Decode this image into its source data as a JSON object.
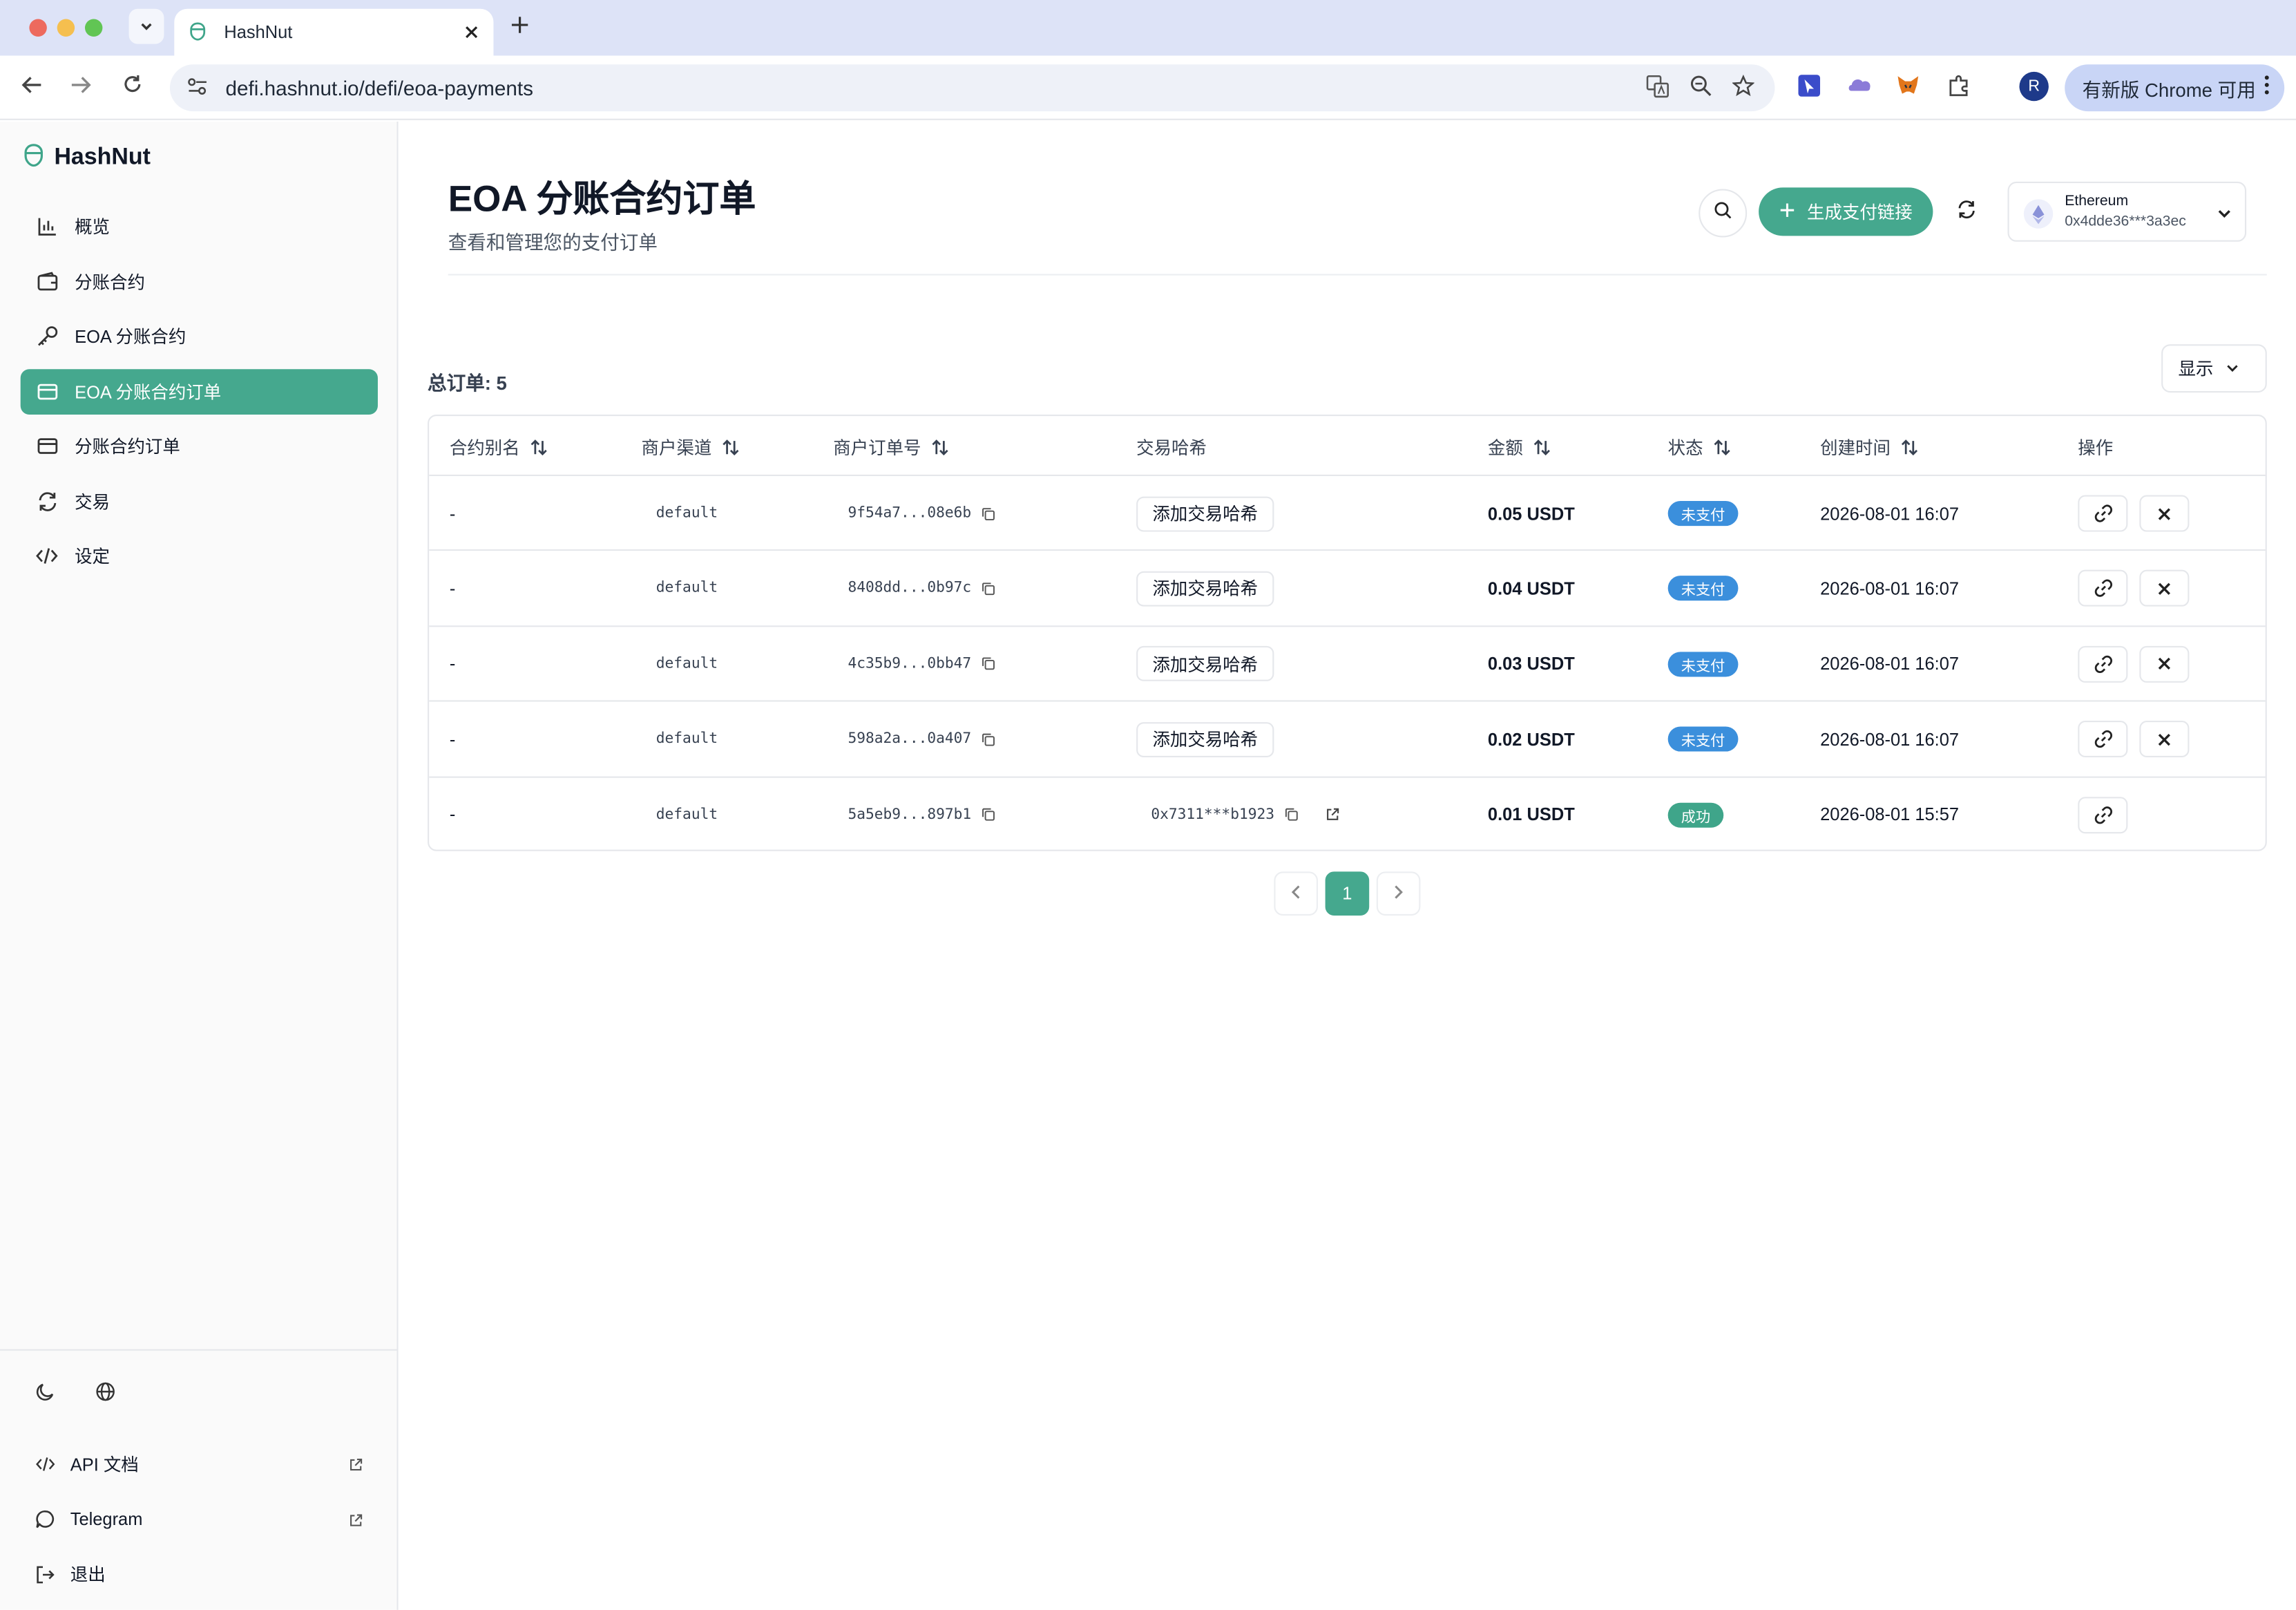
{
  "browser": {
    "tab_title": "HashNut",
    "url": "defi.hashnut.io/defi/eoa-payments",
    "profile_initial": "R",
    "update_label": "有新版 Chrome 可用"
  },
  "sidebar": {
    "brand": "HashNut",
    "items": [
      {
        "label": "概览",
        "icon": "bar-chart-icon"
      },
      {
        "label": "分账合约",
        "icon": "wallet-icon"
      },
      {
        "label": "EOA 分账合约",
        "icon": "key-icon"
      },
      {
        "label": "EOA 分账合约订单",
        "icon": "card-icon"
      },
      {
        "label": "分账合约订单",
        "icon": "card-icon"
      },
      {
        "label": "交易",
        "icon": "refresh-icon"
      },
      {
        "label": "设定",
        "icon": "code-icon"
      }
    ],
    "footer": {
      "api_docs": "API 文档",
      "telegram": "Telegram",
      "logout": "退出"
    }
  },
  "header": {
    "title": "EOA 分账合约订单",
    "subtitle": "查看和管理您的支付订单",
    "generate_label": "生成支付链接",
    "wallet": {
      "network": "Ethereum",
      "address": "0x4dde36***3a3ec"
    }
  },
  "table": {
    "total_label": "总订单: 5",
    "display_label": "显示",
    "columns": [
      "合约别名",
      "商户渠道",
      "商户订单号",
      "交易哈希",
      "金额",
      "状态",
      "创建时间",
      "操作"
    ],
    "add_hash_label": "添加交易哈希",
    "rows": [
      {
        "alias": "-",
        "channel": "default",
        "order_no": "9f54a7...08e6b",
        "hash": "",
        "amount": "0.05 USDT",
        "status": "未支付",
        "status_kind": "unpaid",
        "created": "2026-08-01 16:07"
      },
      {
        "alias": "-",
        "channel": "default",
        "order_no": "8408dd...0b97c",
        "hash": "",
        "amount": "0.04 USDT",
        "status": "未支付",
        "status_kind": "unpaid",
        "created": "2026-08-01 16:07"
      },
      {
        "alias": "-",
        "channel": "default",
        "order_no": "4c35b9...0bb47",
        "hash": "",
        "amount": "0.03 USDT",
        "status": "未支付",
        "status_kind": "unpaid",
        "created": "2026-08-01 16:07"
      },
      {
        "alias": "-",
        "channel": "default",
        "order_no": "598a2a...0a407",
        "hash": "",
        "amount": "0.02 USDT",
        "status": "未支付",
        "status_kind": "unpaid",
        "created": "2026-08-01 16:07"
      },
      {
        "alias": "-",
        "channel": "default",
        "order_no": "5a5eb9...897b1",
        "hash": "0x7311***b1923",
        "amount": "0.01 USDT",
        "status": "成功",
        "status_kind": "success",
        "created": "2026-08-01 15:57"
      }
    ]
  },
  "pagination": {
    "current_page": "1"
  },
  "colors": {
    "accent": "#45a88e",
    "unpaid": "#3b8fdc",
    "success": "#3fa58a"
  }
}
